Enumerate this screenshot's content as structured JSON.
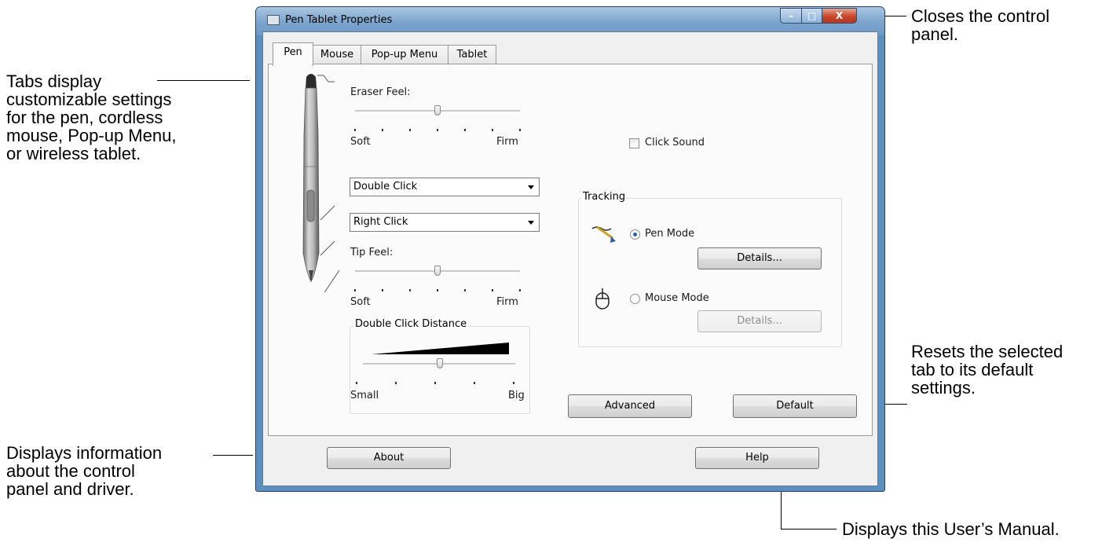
{
  "window": {
    "title": "Pen Tablet Properties",
    "controls": {
      "minimize": "–",
      "maximize": "□",
      "close": "X"
    },
    "tabs": [
      {
        "label": "Pen",
        "active": true
      },
      {
        "label": "Mouse",
        "active": false
      },
      {
        "label": "Pop-up Menu",
        "active": false
      },
      {
        "label": "Tablet",
        "active": false
      }
    ]
  },
  "pen_tab": {
    "eraser_feel": {
      "label": "Eraser Feel:",
      "min_label": "Soft",
      "max_label": "Firm",
      "level": 0.5
    },
    "upper_button": {
      "value": "Double Click"
    },
    "lower_button": {
      "value": "Right Click"
    },
    "tip_feel": {
      "label": "Tip Feel:",
      "min_label": "Soft",
      "max_label": "Firm",
      "level": 0.5
    },
    "double_click_distance": {
      "title": "Double Click Distance",
      "min_label": "Small",
      "max_label": "Big",
      "level": 0.5
    },
    "click_sound": {
      "label": "Click Sound",
      "checked": false
    },
    "tracking": {
      "title": "Tracking",
      "pen_mode": {
        "label": "Pen Mode",
        "selected": true,
        "details": "Details..."
      },
      "mouse_mode": {
        "label": "Mouse Mode",
        "selected": false,
        "details": "Details..."
      }
    },
    "advanced_button": "Advanced",
    "default_button": "Default"
  },
  "footer": {
    "about_button": "About",
    "help_button": "Help"
  },
  "annotations": {
    "tabs": "Tabs display\ncustomizable settings\nfor the pen, cordless\nmouse, Pop-up Menu,\nor wireless tablet.",
    "close": "Closes the control\npanel.",
    "default": "Resets the selected\ntab to its default\nsettings.",
    "about": "Displays information\nabout the control\npanel and driver.",
    "help": "Displays this User’s Manual."
  },
  "colors": {
    "accent_radio": "#2a5fa8",
    "close_button": "#c7462b",
    "window_frame": "#5b8fbf"
  }
}
